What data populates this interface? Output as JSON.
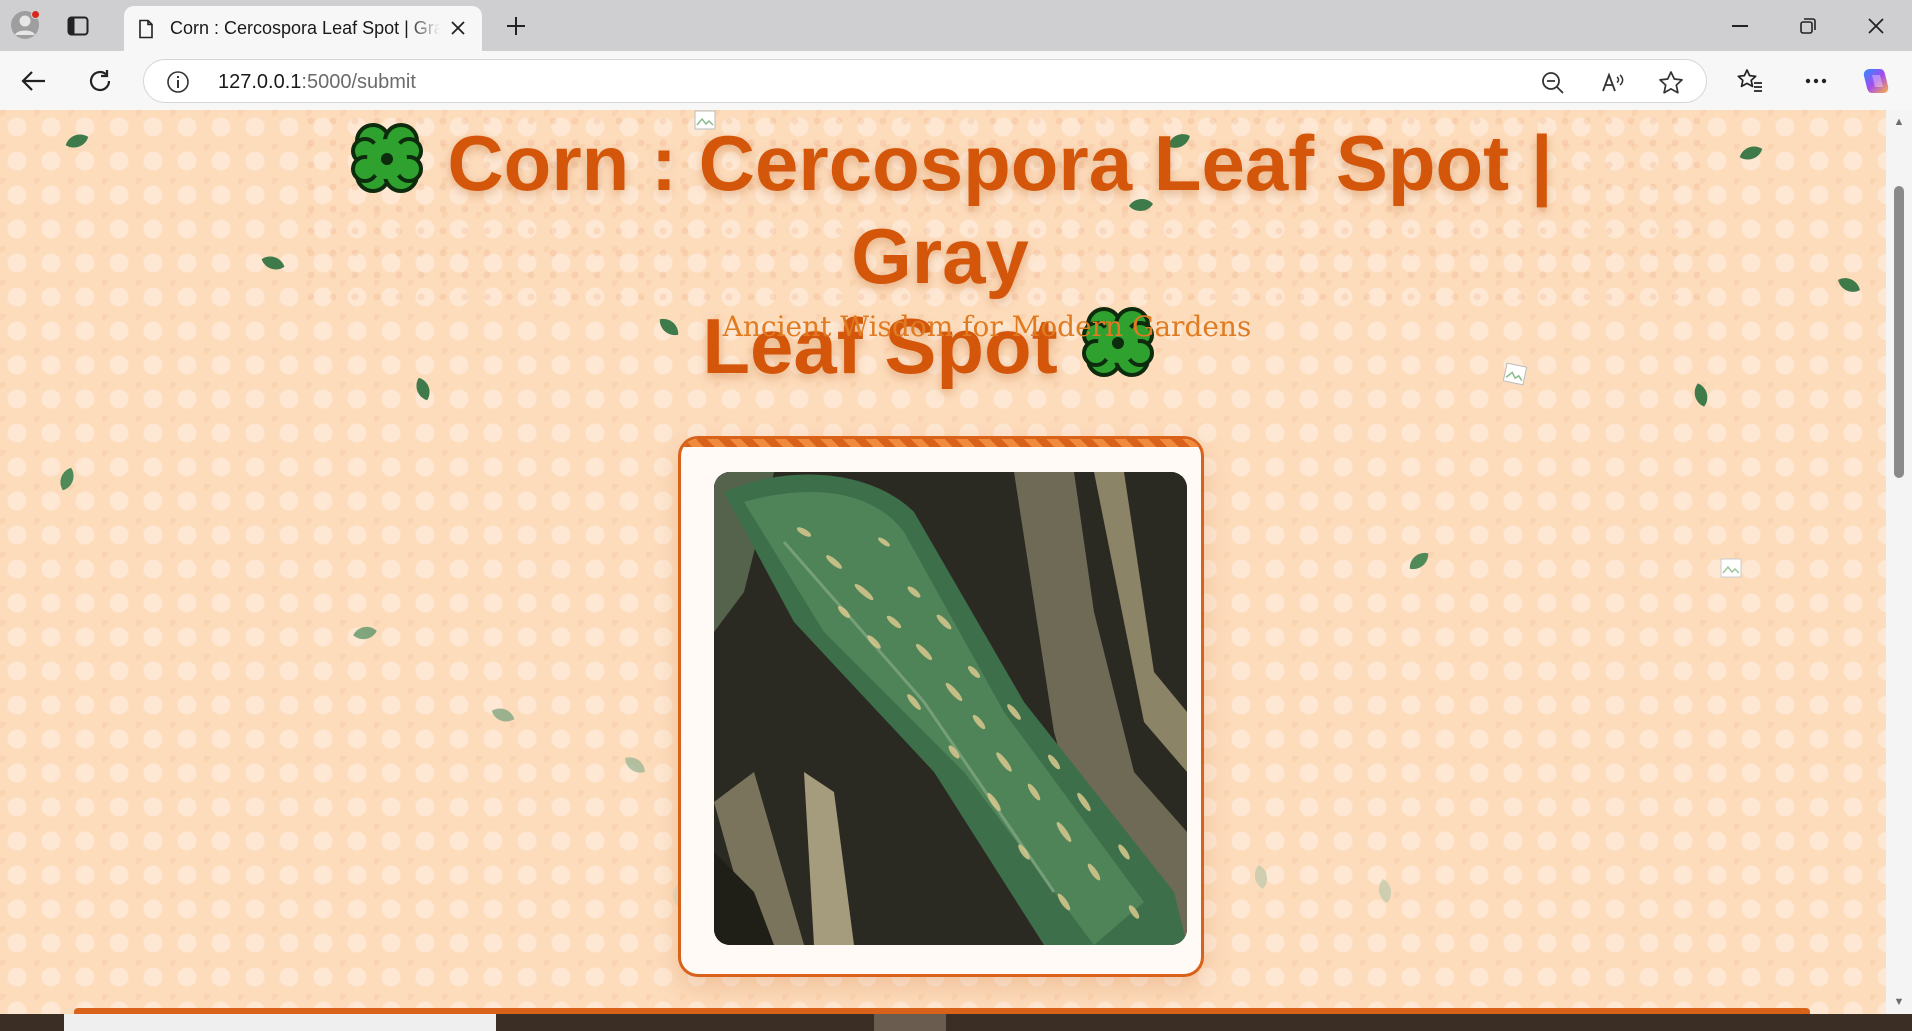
{
  "browser": {
    "tab_title": "Corn : Cercospora Leaf Spot | Gray Leaf Spot",
    "url_host": "127.0.0.1",
    "url_path": ":5000/submit",
    "icons": [
      "profile-icon",
      "tab-actions-icon",
      "page-icon",
      "close-tab-icon",
      "new-tab-icon",
      "minimize-icon",
      "restore-icon",
      "close-window-icon",
      "back-icon",
      "refresh-icon",
      "site-info-icon",
      "zoom-out-icon",
      "read-aloud-icon",
      "favorite-star-icon",
      "favorites-icon",
      "more-icon",
      "copilot-icon"
    ]
  },
  "page": {
    "title_line1": "Corn : Cercospora Leaf Spot | Gray",
    "title_line2": "Leaf Spot",
    "decoration_emoji": "clover-icon",
    "subtitle": "Ancient Wisdom for Modern Gardens",
    "image_alt": "Corn leaf with gray leaf spot lesions",
    "colors": {
      "accent": "#d4560a",
      "subtitle": "#e07b22",
      "background": "#fddcbc",
      "card_border": "#d9621b"
    }
  }
}
